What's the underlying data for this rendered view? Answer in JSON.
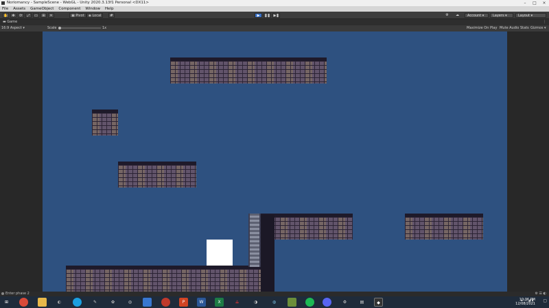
{
  "window": {
    "title": "Noriomancy - SampleScene - WebGL - Unity 2020.3.13f1 Personal <DX11>"
  },
  "menu": [
    "File",
    "Assets",
    "GameObject",
    "Component",
    "Window",
    "Help"
  ],
  "toolbar": {
    "pivot_label": "Pivot",
    "local_label": "Local",
    "account_label": "Account",
    "layers_label": "Layers",
    "layout_label": "Layout"
  },
  "game_panel": {
    "tab_label": "Game",
    "aspect": "16:9 Aspect",
    "scale_label": "Scale",
    "scale_value": "1x",
    "maximize_label": "Maximize On Play",
    "mute_label": "Mute Audio",
    "stats_label": "Stats",
    "gizmos_label": "Gizmos"
  },
  "status": {
    "message": "Enter phase 2"
  },
  "taskbar": {
    "time": "10:36 PM",
    "date": "12/08/2021",
    "apps": [
      "windows",
      "chrome",
      "file-explorer",
      "gamepad",
      "steam-like",
      "pen",
      "paint",
      "photos",
      "chrome-alt",
      "powerpoint",
      "word",
      "excel",
      "acrobat",
      "audacity",
      "network",
      "minecraft",
      "spotify",
      "discord",
      "steam",
      "xbox",
      "unity"
    ]
  },
  "colors": {
    "viewport_bg": "#2e5180",
    "player": "#ffffff",
    "accent": "#3a72c8"
  }
}
